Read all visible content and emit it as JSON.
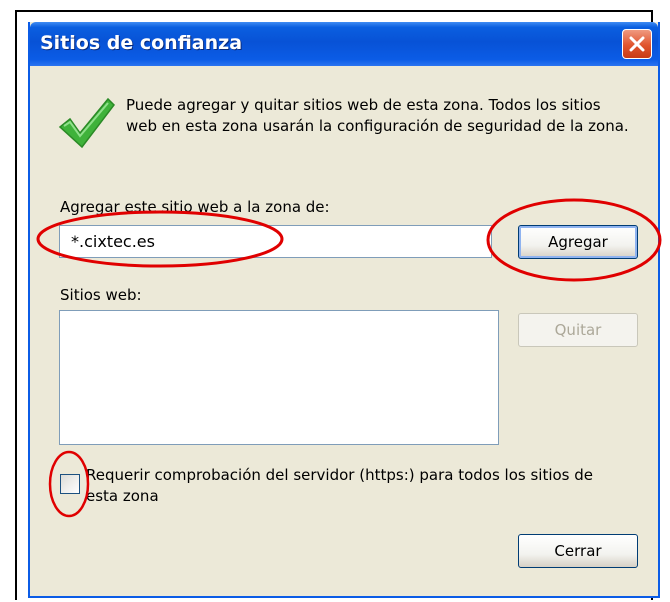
{
  "dialog": {
    "title": "Sitios de confianza",
    "intro_text": "Puede agregar y quitar sitios web de esta zona. Todos los sitios web en esta zona usarán la configuración de seguridad de la zona.",
    "add_label": "Agregar este sitio web a la zona de:",
    "site_input_value": "*.cixtec.es",
    "add_button": "Agregar",
    "sites_label": "Sitios web:",
    "sites_list": [],
    "remove_button": "Quitar",
    "https_checkbox_label": "Requerir comprobación del servidor (https:) para todos los sitios de esta zona",
    "https_checkbox_checked": false,
    "close_button": "Cerrar"
  },
  "icons": {
    "status_icon": "check-icon",
    "window_close": "close-icon"
  },
  "colors": {
    "titlebar": "#0b5ce6",
    "close_button": "#e0542d",
    "dialog_background": "#ece9d8",
    "annotation": "#e00000",
    "check_icon": "#3fb23a"
  }
}
